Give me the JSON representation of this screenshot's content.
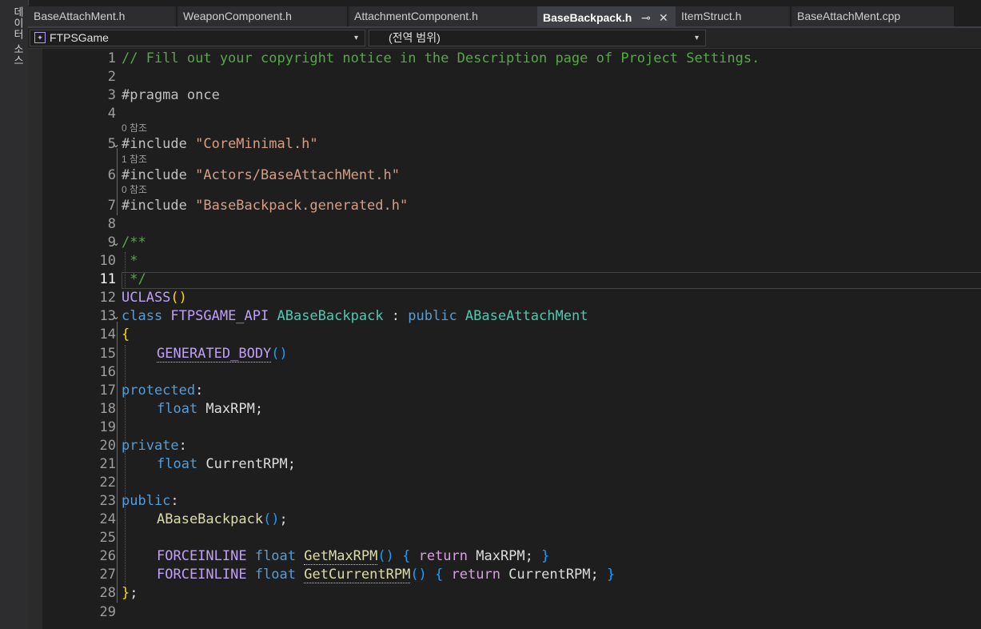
{
  "side_panel": {
    "label": "데이터 소스"
  },
  "tabs": [
    {
      "label": "BaseAttachMent.h",
      "active": false
    },
    {
      "label": "WeaponComponent.h",
      "active": false
    },
    {
      "label": "AttachmentComponent.h",
      "active": false
    },
    {
      "label": "BaseBackpack.h",
      "active": true
    },
    {
      "label": "ItemStruct.h",
      "active": false
    },
    {
      "label": "BaseAttachMent.cpp",
      "active": false
    }
  ],
  "tab_glyphs": {
    "pin": "⊸",
    "close": "✕"
  },
  "navbar": {
    "project": "FTPSGame",
    "scope": "(전역 범위)",
    "caret": "▾",
    "icon": "project-icon"
  },
  "gutter": {
    "line_numbers": [
      "1",
      "2",
      "3",
      "4",
      "5",
      "6",
      "7",
      "8",
      "9",
      "10",
      "11",
      "12",
      "13",
      "14",
      "15",
      "16",
      "17",
      "18",
      "19",
      "20",
      "21",
      "22",
      "23",
      "24",
      "25",
      "26",
      "27",
      "28",
      "29"
    ],
    "current_line": "11"
  },
  "references": {
    "line5": "0 참조",
    "line6": "1 참조",
    "line7": "0 참조"
  },
  "code": {
    "l1": "// Fill out your copyright notice in the Description page of Project Settings.",
    "l3": "#pragma once",
    "l5_dir": "#include ",
    "l5_str": "\"CoreMinimal.h\"",
    "l6_dir": "#include ",
    "l6_str": "\"Actors/BaseAttachMent.h\"",
    "l7_dir": "#include ",
    "l7_str": "\"BaseBackpack.generated.h\"",
    "l9": "/**",
    "l10": " *",
    "l11": " */",
    "l12_macro": "UCLASS",
    "l12_paren": "()",
    "l13_kw": "class ",
    "l13_api": "FTPSGAME_API ",
    "l13_cls": "ABaseBackpack",
    "l13_colon": " : ",
    "l13_pub": "public ",
    "l13_base": "ABaseAttachMent",
    "l14": "{",
    "l15_macro": "GENERATED_BODY",
    "l15_paren": "()",
    "l17_kw": "protected",
    "l17_colon": ":",
    "l18_type": "float ",
    "l18_name": "MaxRPM;",
    "l20_kw": "private",
    "l20_colon": ":",
    "l21_type": "float ",
    "l21_name": "CurrentRPM;",
    "l23_kw": "public",
    "l23_colon": ":",
    "l24_fn": "ABaseBackpack",
    "l24_paren": "()",
    "l24_semi": ";",
    "l26_macro": "FORCEINLINE ",
    "l26_type": "float ",
    "l26_fn": "GetMaxRPM",
    "l26_paren": "()",
    "l26_open": " { ",
    "l26_ret": "return ",
    "l26_val": "MaxRPM; ",
    "l26_close": "}",
    "l27_macro": "FORCEINLINE ",
    "l27_type": "float ",
    "l27_fn": "GetCurrentRPM",
    "l27_paren": "()",
    "l27_open": " { ",
    "l27_ret": "return ",
    "l27_val": "CurrentRPM; ",
    "l27_close": "}",
    "l28_brace": "}",
    "l28_semi": ";"
  },
  "colors": {
    "background": "#1e1e1e",
    "comment": "#57a64a",
    "keyword": "#569cd6",
    "string": "#d69d85",
    "macro": "#bea0f5",
    "type": "#4ec9b0",
    "function": "#dcdcaa",
    "control": "#d8a0df"
  }
}
